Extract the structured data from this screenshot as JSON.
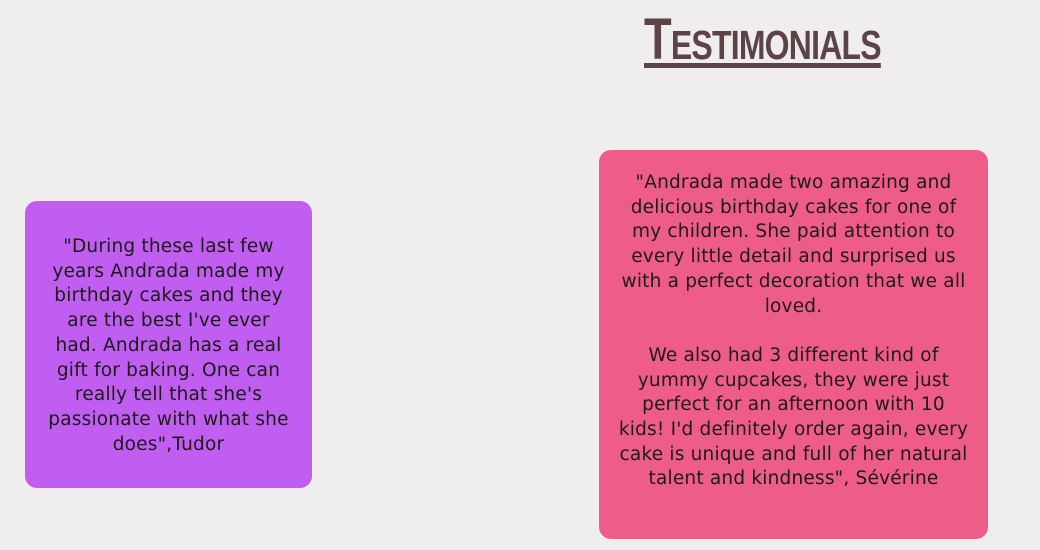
{
  "header": {
    "title": "Testimonials"
  },
  "testimonials": [
    {
      "text": "\"During these last few years Andrada made my birthday cakes and they are the best I've ever had. Andrada has a real gift for baking. One can really tell that she's passionate with what she does\",Tudor",
      "color": "#bf5ef0"
    },
    {
      "paragraph_1": "\"Andrada made two amazing and delicious birthday cakes for one of my children. She paid attention to every little detail and surprised us with a perfect decoration that we all loved.",
      "paragraph_2": "We also had 3 different kind of yummy cupcakes, they were just perfect for an afternoon with 10 kids! I'd definitely order again, every cake is unique and full of her natural talent and kindness\", Sévérine",
      "color": "#ee5d8a"
    }
  ],
  "colors": {
    "background": "#efeded",
    "title": "#5b4347"
  }
}
